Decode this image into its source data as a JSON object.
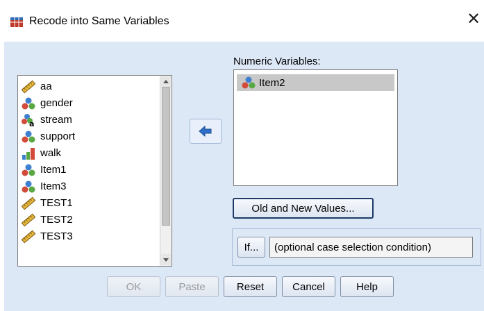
{
  "window": {
    "title": "Recode into Same Variables",
    "close_glyph": "✕"
  },
  "source_list": {
    "items": [
      {
        "name": "aa",
        "icon": "scale-ruler-icon"
      },
      {
        "name": "gender",
        "icon": "nominal-icon"
      },
      {
        "name": "stream",
        "icon": "string-nominal-icon"
      },
      {
        "name": "support",
        "icon": "nominal-icon"
      },
      {
        "name": "walk",
        "icon": "ordinal-icon"
      },
      {
        "name": "Item1",
        "icon": "nominal-icon"
      },
      {
        "name": "Item3",
        "icon": "nominal-icon"
      },
      {
        "name": "TEST1",
        "icon": "scale-ruler-icon"
      },
      {
        "name": "TEST2",
        "icon": "scale-ruler-icon"
      },
      {
        "name": "TEST3",
        "icon": "scale-ruler-icon"
      }
    ]
  },
  "move_button": {
    "icon": "arrow-left-icon"
  },
  "numeric_variables": {
    "label": "Numeric Variables:",
    "items": [
      {
        "name": "Item2",
        "icon": "nominal-icon",
        "selected": true
      }
    ]
  },
  "buttons": {
    "old_new": "Old and New Values...",
    "if": "If...",
    "ok": "OK",
    "paste": "Paste",
    "reset": "Reset",
    "cancel": "Cancel",
    "help": "Help"
  },
  "condition": {
    "text": "(optional case selection condition)"
  },
  "colors": {
    "dialog_bg": "#dde8f7",
    "selection": "#c8c8c8",
    "accent": "#2f6fc7"
  }
}
